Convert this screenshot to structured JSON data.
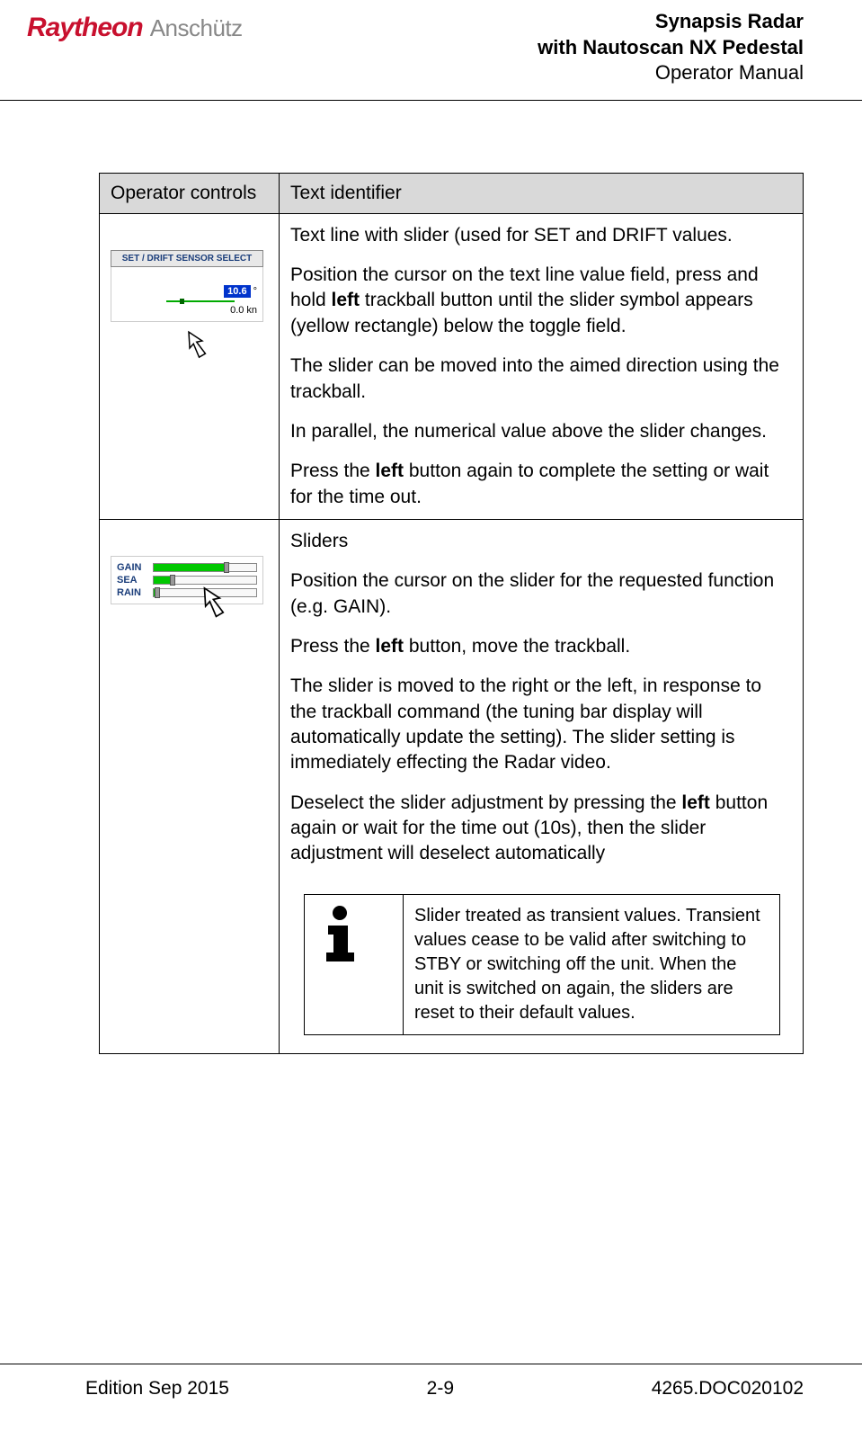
{
  "header": {
    "logo1": "Raytheon",
    "logo2": "Anschütz",
    "title1": "Synapsis Radar",
    "title2": "with Nautoscan NX Pedestal",
    "title3": "Operator Manual"
  },
  "table": {
    "h1": "Operator controls",
    "h2": "Text identifier",
    "row1": {
      "img": {
        "title": "SET / DRIFT SENSOR SELECT",
        "val1": "10.6",
        "unit1": "°",
        "val2": "0.0",
        "unit2": "kn"
      },
      "p1": "Text line with slider (used for SET and DRIFT values.",
      "p2a": "Position the cursor on the text line value field, press and hold ",
      "p2b": "left",
      "p2c": " trackball button until the slider symbol appears (yellow rectangle) below the toggle field.",
      "p3": "The slider can be moved into the aimed direction using the trackball.",
      "p4": "In parallel, the numerical value above the slider changes.",
      "p5a": "Press the ",
      "p5b": "left",
      "p5c": " button again to complete the setting or wait for the time out."
    },
    "row2": {
      "sliders": {
        "gain": "GAIN",
        "sea": "SEA",
        "rain": "RAIN"
      },
      "p1": "Sliders",
      "p2": "Position the cursor on the slider for the requested function (e.g. GAIN).",
      "p3a": "Press the ",
      "p3b": "left",
      "p3c": " button, move the trackball.",
      "p4": "The slider is moved to the right or the left, in response to the trackball command (the tuning bar display will automatically update the setting). The slider setting is immediately effecting the Radar video.",
      "p5a": "Deselect the slider adjustment by pressing the ",
      "p5b": "left",
      "p5c": " button again or wait for the time out (10s), then the slider adjustment will deselect automatically",
      "note": "Slider treated as transient values. Transient values cease to be valid after switching to STBY or switching off the unit. When the unit is switched on again, the sliders are reset to their default values."
    }
  },
  "footer": {
    "edition": "Edition Sep 2015",
    "page": "2-9",
    "docnum": "4265.DOC020102"
  }
}
